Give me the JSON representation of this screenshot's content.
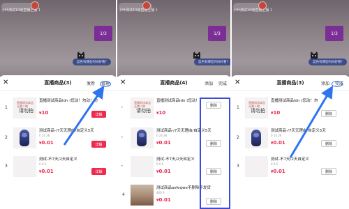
{
  "screens": [
    {
      "host_name": "小叶测试10级直播上播 1",
      "live_card_text": "1/3",
      "live_pill_text": "蓝色有哪些时间好看?",
      "title": "直播商品(3)",
      "actions": [
        "发券",
        "管理"
      ],
      "items": [
        {
          "index": "1",
          "name": "直播测试商品ldn (您动！勿动！勿",
          "stats": "",
          "price": "10",
          "button": "详解"
        },
        {
          "index": "2",
          "name": "测试商品-/7天无理由/自定义5天",
          "stats": "0  24.36",
          "price": "0.01",
          "button": "详解"
        },
        {
          "index": "3",
          "name": "测试-不7天/2天自定义",
          "stats": "0  0.5",
          "price": "0.01",
          "button": "详解"
        }
      ]
    },
    {
      "host_name": "小叶测试10级直播上播 1",
      "live_card_text": "1/3",
      "live_pill_text": "蓝色有哪些时间好看?",
      "title": "直播商品(4)",
      "actions": [
        "添加",
        "完成"
      ],
      "items": [
        {
          "index": "1",
          "name": "直播测试商品ldn (您动！",
          "stats": "",
          "price": "10",
          "button": "删除"
        },
        {
          "index": "2",
          "name": "测试商品-/7天无理由/自定义5天",
          "stats": "0  24.36",
          "price": "0.01",
          "button": "删除"
        },
        {
          "index": "3",
          "name": "测试-不7天/2天自定义",
          "stats": "0  0.5",
          "price": "0.01",
          "button": "删除"
        },
        {
          "index": "4",
          "name": "测试商品asfeqwe不删除不发货",
          "stats": "460  0",
          "price": "0.01",
          "button": "删除"
        }
      ]
    },
    {
      "host_name": "小叶测试10级直播上播 1",
      "live_card_text": "1/3",
      "live_pill_text": "蓝色有哪些时间好看?",
      "title": "直播商品(3)",
      "actions": [
        "添加",
        "完成"
      ],
      "items": [
        {
          "index": "1",
          "name": "直播测试商品ldn (您动！勿",
          "stats": "",
          "price": "10",
          "button": "删除"
        },
        {
          "index": "2",
          "name": "测试商品-/7天无理由/自定义5天",
          "stats": "0  24.36",
          "price": "0.01",
          "button": "删除"
        },
        {
          "index": "3",
          "name": "测试-不7天/2天自定义",
          "stats": "0  0.5",
          "price": "0.01",
          "button": "删除"
        }
      ]
    }
  ],
  "thumb_doc": {
    "line1": "直播测试商品",
    "line2": "无需人物",
    "big": "请勿拍"
  },
  "currency": "¥",
  "colors": {
    "accent": "#ee2a4e",
    "annotation": "#2e73f0",
    "highlight": "#3b4bd6",
    "live_card": "#7b2e95"
  }
}
